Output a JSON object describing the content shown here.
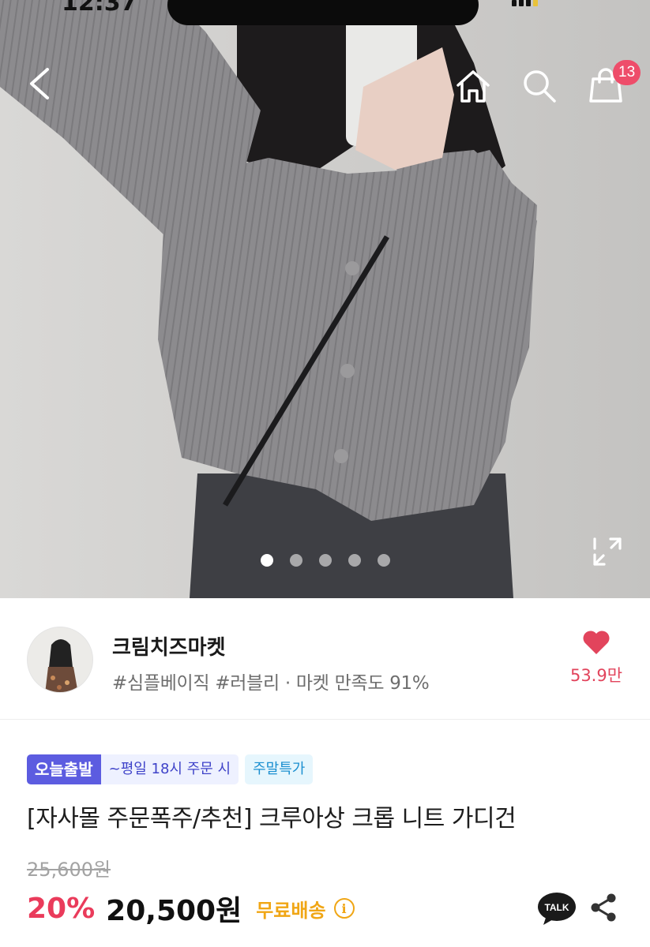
{
  "status_bar": {
    "time": "12:37"
  },
  "nav": {
    "back_icon": "chevron-left-icon",
    "home_icon": "home-icon",
    "search_icon": "search-icon",
    "cart_icon": "shopping-bag-icon",
    "cart_count": "13"
  },
  "gallery": {
    "total_images": 5,
    "current_index": 1
  },
  "seller": {
    "name": "크림치즈마켓",
    "meta": "#심플베이직 #러블리 · 마켓 만족도 91%",
    "likes": "53.9만"
  },
  "product": {
    "badge_today": "오늘출발",
    "badge_time": "~평일 18시 주문 시",
    "badge_weekend": "주말특가",
    "title": "[자사몰 주문폭주/추천] 크루아상 크롭 니트 가디건",
    "original_price": "25,600원",
    "discount": "20%",
    "price": "20,500원",
    "shipping": "무료배송",
    "talk_label": "TALK"
  },
  "colors": {
    "accent_pink": "#ea3b5b",
    "badge_purple": "#5c5ce0",
    "shipping_yellow": "#f0a615"
  }
}
